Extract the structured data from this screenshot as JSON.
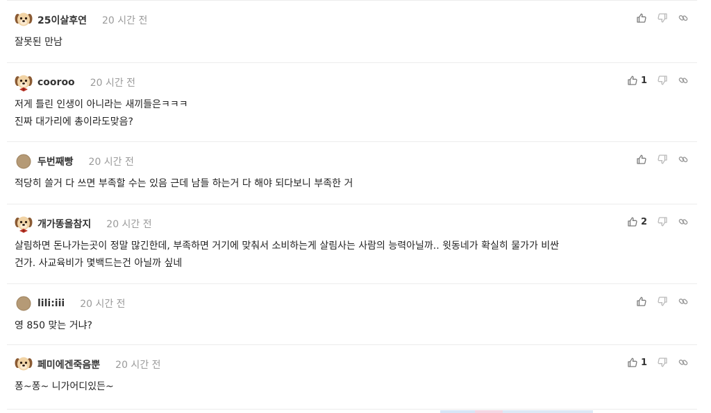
{
  "comments": [
    {
      "avatar": "puppy-avatar",
      "author": "25이살후연",
      "time": "20 시간 전",
      "body": [
        "잘못된 만남"
      ],
      "likes": ""
    },
    {
      "avatar": "puppy-bowtie-avatar",
      "author": "cooroo",
      "time": "20 시간 전",
      "body": [
        "저게 틀린 인생이 아니라는 새끼들은ㅋㅋㅋ",
        "진짜 대가리에 총이라도맞음?"
      ],
      "likes": "1"
    },
    {
      "avatar": "brown-dot-avatar",
      "author": "두번째빵",
      "time": "20 시간 전",
      "body": [
        "적당히 쓸거 다 쓰면 부족할 수는 있음 근데 남들 하는거 다 해야 되다보니 부족한 거"
      ],
      "likes": ""
    },
    {
      "avatar": "puppy-bowtie-avatar",
      "author": "개가똥을참지",
      "time": "20 시간 전",
      "body": [
        "살림하면 돈나가는곳이 정말 많긴한데, 부족하면 거기에 맞춰서 소비하는게 살림사는 사람의 능력아닐까.. 윗동네가 확실히 물가가 비싼",
        "건가. 사교육비가 몇백드는건 아닐까 싶네"
      ],
      "likes": "2"
    },
    {
      "avatar": "brown-dot-avatar",
      "author": "lili:iii",
      "time": "20 시간 전",
      "body": [
        "영 850 맞는 거냐?"
      ],
      "likes": ""
    },
    {
      "avatar": "puppy-avatar",
      "author": "페미에겐죽음뿐",
      "time": "20 시간 전",
      "body": [
        "퐁~퐁~ 니가어디있든~"
      ],
      "likes": "1"
    }
  ],
  "icons": {
    "like": "thumbs-up-icon",
    "dislike": "thumbs-down-icon",
    "link": "link-icon"
  },
  "colors": {
    "border": "#ececec",
    "meta": "#9a9a9a",
    "icon": "#8a8a8a"
  }
}
